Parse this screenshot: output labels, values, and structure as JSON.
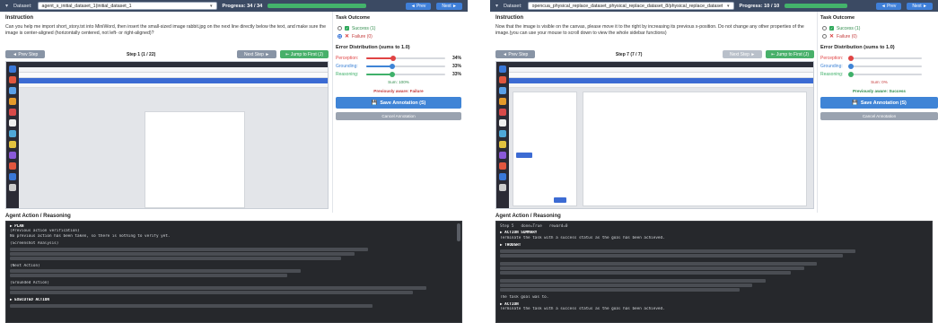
{
  "panels": [
    {
      "dataset_label": "Dataset:",
      "dataset_value": "agent_s_initial_dataset_1(initial_dataset_1",
      "progress_text": "Progress: 34 / 34",
      "progress_fraction": 1.0,
      "prev_label": "◄ Prev",
      "next_label": "Next ►",
      "instruction_title": "Instruction",
      "instruction_text": "Can you help me import short_story.txt into MiniWord, then insert the small-sized image rabbit.jpg on the next line directly below the text, and make sure the image is center-aligned (horizontally centered, not left- or right-aligned)?",
      "prev_step_label": "◄ Prev Step",
      "step_label": "Step 1 (1 / 22)",
      "next_step_label": "Next Step ►",
      "jump_label": "⇤ Jump to First (J)",
      "task_outcome_title": "Task Outcome",
      "success_label": "Success (1)",
      "failure_label": "Failure (0)",
      "selected_outcome": "failure",
      "error_title": "Error Distribution  (sums to 1.0)",
      "perception_label": "Perception:",
      "perception_value": "34%",
      "perception_frac": 0.34,
      "grounding_label": "Grounding:",
      "grounding_value": "33%",
      "grounding_frac": 0.33,
      "reasoning_label": "Reasoning:",
      "reasoning_value": "33%",
      "reasoning_frac": 0.33,
      "sum_text": "Sum: 100%",
      "prev_aware_text": "Previously aware: Failure",
      "save_label": "Save Annotation (S)",
      "cancel_label": "Cancel Annotation",
      "agent_title": "Agent Action / Reasoning",
      "console": [
        {
          "cls": "hd",
          "text": "▶ PLAN"
        },
        {
          "cls": "ln",
          "text": "(Previous action verification)"
        },
        {
          "cls": "ln",
          "text": "No previous action has been taken, so there is nothing to verify yet."
        },
        {
          "cls": "gap",
          "text": ""
        },
        {
          "cls": "ln",
          "text": "(Screenshot Analysis)"
        },
        {
          "cls": "ph",
          "text": ""
        },
        {
          "cls": "ph",
          "text": ""
        },
        {
          "cls": "ph",
          "text": ""
        },
        {
          "cls": "gap",
          "text": ""
        },
        {
          "cls": "ln",
          "text": "(Next Action)"
        },
        {
          "cls": "ph",
          "text": ""
        },
        {
          "cls": "ph",
          "text": ""
        },
        {
          "cls": "gap",
          "text": ""
        },
        {
          "cls": "ln",
          "text": "(Grounded Action)"
        },
        {
          "cls": "ph",
          "text": ""
        },
        {
          "cls": "ph",
          "text": ""
        },
        {
          "cls": "gap",
          "text": ""
        },
        {
          "cls": "hd",
          "text": "▶ EXECUTED ACTION"
        },
        {
          "cls": "ph",
          "text": ""
        }
      ]
    },
    {
      "dataset_label": "Dataset:",
      "dataset_value": "opencua_physical_replace_dataset_physical_replace_dataset_8/physical_replace_dataset",
      "progress_text": "Progress: 10 / 10",
      "progress_fraction": 1.0,
      "prev_label": "◄ Prev",
      "next_label": "Next ►",
      "instruction_title": "Instruction",
      "instruction_text": "Now that the image is visible on the canvas, please move it to the right by increasing its previous x-position. Do not change any other properties of the image.(you can use your mouse to scroll down to view the whole sidebar functions)",
      "prev_step_label": "◄ Prev Step",
      "step_label": "Step 7 (7 / 7)",
      "next_step_label": "Next Step ►",
      "jump_label": "⇤ Jump to First (J)",
      "task_outcome_title": "Task Outcome",
      "success_label": "Success (1)",
      "failure_label": "Failure (0)",
      "selected_outcome": "none",
      "error_title": "Error Distribution  (sums to 1.0)",
      "perception_label": "Perception:",
      "perception_value": "",
      "perception_frac": 0.0,
      "grounding_label": "Grounding:",
      "grounding_value": "",
      "grounding_frac": 0.0,
      "reasoning_label": "Reasoning:",
      "reasoning_value": "",
      "reasoning_frac": 0.0,
      "sum_text": "Sum: 0%",
      "prev_aware_text": "Previously aware: Success",
      "save_label": "Save Annotation (S)",
      "cancel_label": "Cancel Annotation",
      "agent_title": "Agent Action / Reasoning",
      "console_header": [
        "Step 5",
        "done=True",
        "reward=0"
      ],
      "console": [
        {
          "cls": "hd",
          "text": "▶ ACTION SUMMARY"
        },
        {
          "cls": "ln",
          "text": "Terminate the task with a success status as the goal has been achieved."
        },
        {
          "cls": "gap",
          "text": ""
        },
        {
          "cls": "hd",
          "text": "▶ THOUGHT"
        },
        {
          "cls": "ph",
          "text": ""
        },
        {
          "cls": "ph",
          "text": ""
        },
        {
          "cls": "gap",
          "text": ""
        },
        {
          "cls": "ph",
          "text": ""
        },
        {
          "cls": "ph",
          "text": ""
        },
        {
          "cls": "ph",
          "text": ""
        },
        {
          "cls": "gap",
          "text": ""
        },
        {
          "cls": "ph",
          "text": ""
        },
        {
          "cls": "ph",
          "text": ""
        },
        {
          "cls": "ph",
          "text": ""
        },
        {
          "cls": "gap",
          "text": ""
        },
        {
          "cls": "ln",
          "text": "The task goal was to."
        },
        {
          "cls": "gap",
          "text": ""
        },
        {
          "cls": "hd",
          "text": "▶ ACTION"
        },
        {
          "cls": "ln",
          "text": "Terminate the task with a success status as the goal has been achieved."
        }
      ]
    }
  ],
  "colors": {
    "topbar": "#3b4a63",
    "accent_blue": "#3f84d6",
    "success_green": "#2ea85a",
    "failure_red": "#d83a3a",
    "perception": "#e04444",
    "grounding": "#3f84d6",
    "reasoning": "#3fb06a",
    "console_bg": "#26282c"
  },
  "icons": [
    "chevron-down-icon",
    "check-icon",
    "x-icon",
    "save-icon",
    "scrollbar"
  ]
}
